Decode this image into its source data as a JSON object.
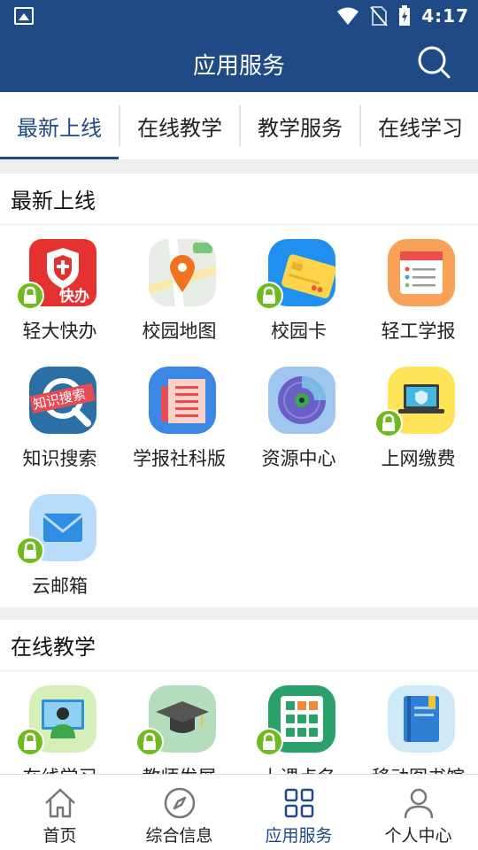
{
  "status_bar": {
    "time": "4:17"
  },
  "header": {
    "title": "应用服务"
  },
  "tabs": [
    {
      "label": "最新上线",
      "active": true
    },
    {
      "label": "在线教学",
      "active": false
    },
    {
      "label": "教学服务",
      "active": false
    },
    {
      "label": "在线学习",
      "active": false
    }
  ],
  "sections": [
    {
      "title": "最新上线",
      "apps": [
        {
          "label": "轻大快办",
          "icon": "shield-app-icon",
          "locked": true,
          "badge_text": "快办"
        },
        {
          "label": "校园地图",
          "icon": "map-pin-icon",
          "locked": false
        },
        {
          "label": "校园卡",
          "icon": "card-icon",
          "locked": true
        },
        {
          "label": "轻工学报",
          "icon": "form-list-icon",
          "locked": false
        },
        {
          "label": "知识搜索",
          "icon": "magnifier-icon",
          "locked": false,
          "badge_text": "知识搜索"
        },
        {
          "label": "学报社科版",
          "icon": "newspaper-icon",
          "locked": false
        },
        {
          "label": "资源中心",
          "icon": "disc-icon",
          "locked": false
        },
        {
          "label": "上网缴费",
          "icon": "laptop-icon",
          "locked": true
        },
        {
          "label": "云邮箱",
          "icon": "mail-icon",
          "locked": true
        }
      ]
    },
    {
      "title": "在线教学",
      "apps": [
        {
          "label": "在线学习",
          "icon": "teacher-screen-icon",
          "locked": true
        },
        {
          "label": "教师发展",
          "icon": "graduation-cap-icon",
          "locked": true
        },
        {
          "label": "上课点名",
          "icon": "roll-call-icon",
          "locked": true
        },
        {
          "label": "移动图书馆",
          "icon": "book-icon",
          "locked": false
        }
      ]
    }
  ],
  "bottom_nav": [
    {
      "label": "首页",
      "icon": "home-icon",
      "active": false
    },
    {
      "label": "综合信息",
      "icon": "compass-icon",
      "active": false
    },
    {
      "label": "应用服务",
      "icon": "grid-icon",
      "active": true
    },
    {
      "label": "个人中心",
      "icon": "user-icon",
      "active": false
    }
  ],
  "colors": {
    "primary": "#1f4a86",
    "lock_green": "#6fbb1f"
  }
}
